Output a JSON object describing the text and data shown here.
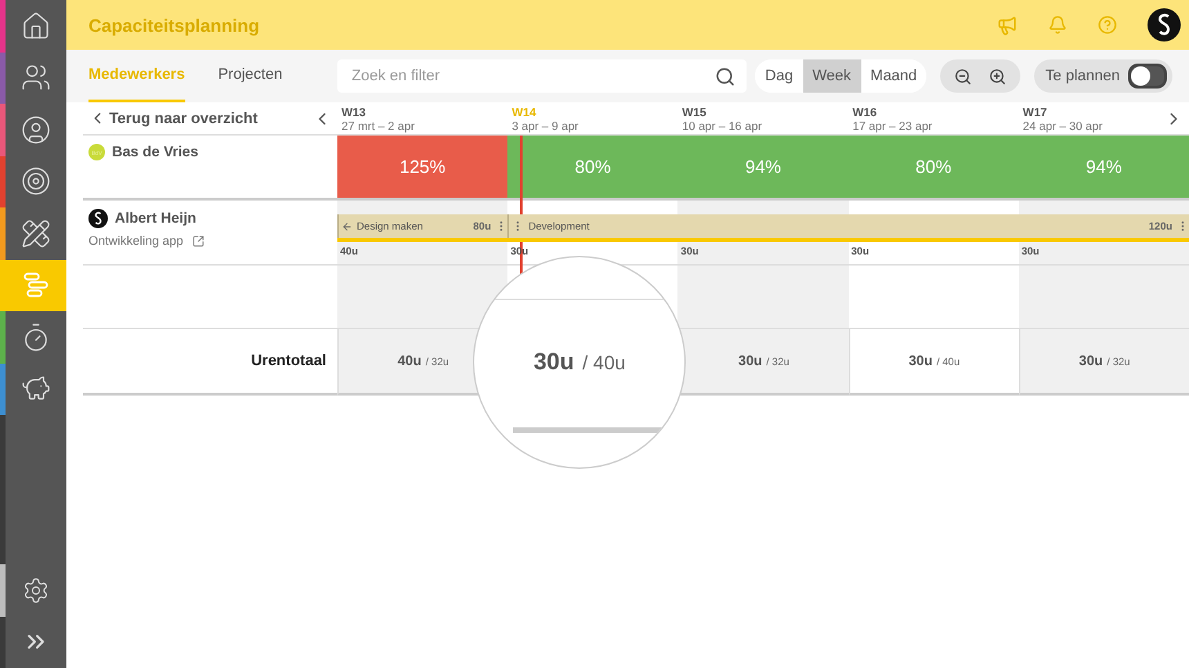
{
  "sidebar": {
    "items": [
      {
        "color": "#e5338a",
        "selected": false
      },
      {
        "color": "#8a5aa8",
        "selected": false
      },
      {
        "color": "#e9577a",
        "selected": false
      },
      {
        "color": "#e2412f",
        "selected": false
      },
      {
        "color": "#f29a1e",
        "selected": false
      },
      {
        "color": "#f9c900",
        "selected": true
      },
      {
        "color": "#5db14b",
        "selected": false
      },
      {
        "color": "#3d8fd1",
        "selected": false
      }
    ],
    "settings": {
      "color": "#bdbdbd",
      "selected": false
    }
  },
  "header": {
    "title": "Capaciteitsplanning"
  },
  "tabs": [
    {
      "label": "Medewerkers",
      "selected": true
    },
    {
      "label": "Projecten",
      "selected": false
    }
  ],
  "search": {
    "placeholder": "Zoek en filter"
  },
  "view_modes": [
    {
      "label": "Dag",
      "selected": false
    },
    {
      "label": "Week",
      "selected": true
    },
    {
      "label": "Maand",
      "selected": false
    }
  ],
  "toggle": {
    "label": "Te plannen",
    "on": false
  },
  "back_link": "Terug naar overzicht",
  "weeks": [
    {
      "label": "W13",
      "dates": "27 mrt – 2 apr",
      "current": false,
      "shaded": true
    },
    {
      "label": "W14",
      "dates": "3 apr – 9 apr",
      "current": true,
      "shaded": false
    },
    {
      "label": "W15",
      "dates": "10 apr – 16 apr",
      "current": false,
      "shaded": true
    },
    {
      "label": "W16",
      "dates": "17 apr – 23 apr",
      "current": false,
      "shaded": false
    },
    {
      "label": "W17",
      "dates": "24 apr – 30 apr",
      "current": false,
      "shaded": true
    }
  ],
  "employee": {
    "initials": "BdV",
    "name": "Bas de Vries",
    "utilization": [
      {
        "value": "125%",
        "color": "#e85c4a"
      },
      {
        "value": "80%",
        "color": "#6db85a"
      },
      {
        "value": "94%",
        "color": "#6db85a"
      },
      {
        "value": "80%",
        "color": "#6db85a"
      },
      {
        "value": "94%",
        "color": "#6db85a"
      }
    ]
  },
  "project": {
    "client": "Albert Heijn",
    "name": "Ontwikkeling app",
    "tasks": [
      {
        "name": "Design maken",
        "total": "80u",
        "weeks": [
          "40u"
        ]
      },
      {
        "name": "Development",
        "total": "120u",
        "weeks": [
          "30u",
          "30u",
          "30u",
          "30u"
        ]
      }
    ]
  },
  "totals": {
    "label": "Urentotaal",
    "cells": [
      {
        "hours": "40u",
        "capacity": "/ 32u",
        "magnified": false
      },
      {
        "hours": "30u",
        "capacity": "/ 40u",
        "magnified": true
      },
      {
        "hours": "30u",
        "capacity": "/ 32u",
        "magnified": false
      },
      {
        "hours": "30u",
        "capacity": "/ 40u",
        "magnified": false
      },
      {
        "hours": "30u",
        "capacity": "/ 32u",
        "magnified": false
      }
    ]
  }
}
